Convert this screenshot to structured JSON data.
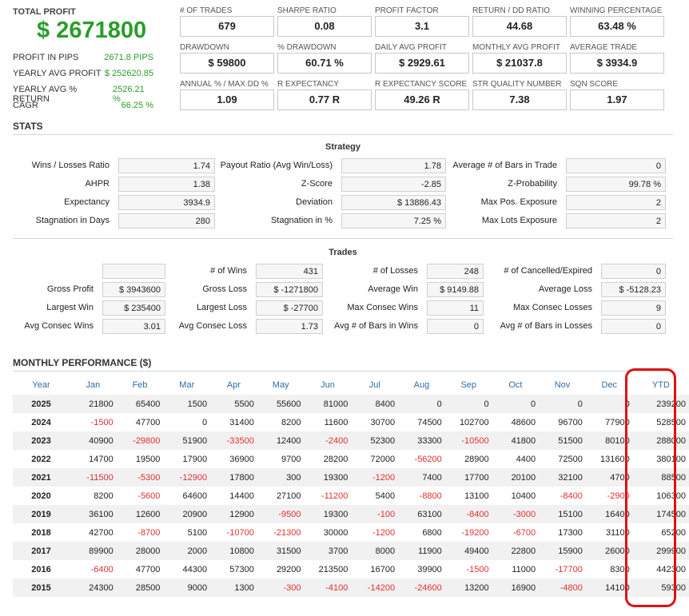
{
  "summary": {
    "total_profit_label": "TOTAL PROFIT",
    "total_profit_value": "$ 2671800",
    "rows": [
      {
        "label": "PROFIT IN PIPS",
        "value": "2671.8 PIPS"
      },
      {
        "label": "YEARLY AVG PROFIT",
        "value": "$ 252620.85"
      },
      {
        "label": "YEARLY AVG % RETURN",
        "value": "2526.21 %"
      },
      {
        "label": "CAGR",
        "value": "66.25 %"
      }
    ]
  },
  "metrics": [
    {
      "label": "# OF TRADES",
      "value": "679"
    },
    {
      "label": "SHARPE RATIO",
      "value": "0.08"
    },
    {
      "label": "PROFIT FACTOR",
      "value": "3.1"
    },
    {
      "label": "RETURN / DD RATIO",
      "value": "44.68"
    },
    {
      "label": "WINNING PERCENTAGE",
      "value": "63.48 %"
    },
    {
      "label": "DRAWDOWN",
      "value": "$ 59800"
    },
    {
      "label": "% DRAWDOWN",
      "value": "60.71 %"
    },
    {
      "label": "DAILY AVG PROFIT",
      "value": "$ 2929.61"
    },
    {
      "label": "MONTHLY AVG PROFIT",
      "value": "$ 21037.8"
    },
    {
      "label": "AVERAGE TRADE",
      "value": "$ 3934.9"
    },
    {
      "label": "ANNUAL % / MAX DD %",
      "value": "1.09"
    },
    {
      "label": "R EXPECTANCY",
      "value": "0.77 R"
    },
    {
      "label": "R EXPECTANCY SCORE",
      "value": "49.26 R"
    },
    {
      "label": "STR QUALITY NUMBER",
      "value": "7.38"
    },
    {
      "label": "SQN SCORE",
      "value": "1.97"
    }
  ],
  "stats_title": "STATS",
  "strategy": {
    "title": "Strategy",
    "rows": [
      [
        {
          "label": "Wins / Losses Ratio",
          "value": "1.74"
        },
        {
          "label": "Payout Ratio (Avg Win/Loss)",
          "value": "1.78"
        },
        {
          "label": "Average # of Bars in Trade",
          "value": "0"
        }
      ],
      [
        {
          "label": "AHPR",
          "value": "1.38"
        },
        {
          "label": "Z-Score",
          "value": "-2.85"
        },
        {
          "label": "Z-Probability",
          "value": "99.78 %"
        }
      ],
      [
        {
          "label": "Expectancy",
          "value": "3934.9"
        },
        {
          "label": "Deviation",
          "value": "$ 13886.43"
        },
        {
          "label": "Max Pos. Exposure",
          "value": "2"
        }
      ],
      [
        {
          "label": "Stagnation in Days",
          "value": "280"
        },
        {
          "label": "Stagnation in %",
          "value": "7.25 %"
        },
        {
          "label": "Max Lots Exposure",
          "value": "2"
        }
      ]
    ]
  },
  "trades": {
    "title": "Trades",
    "rows": [
      [
        {
          "label": "",
          "value": ""
        },
        {
          "label": "# of Wins",
          "value": "431"
        },
        {
          "label": "# of Losses",
          "value": "248"
        },
        {
          "label": "# of Cancelled/Expired",
          "value": "0"
        }
      ],
      [
        {
          "label": "Gross Profit",
          "value": "$ 3943600"
        },
        {
          "label": "Gross Loss",
          "value": "$ -1271800"
        },
        {
          "label": "Average Win",
          "value": "$ 9149.88"
        },
        {
          "label": "Average Loss",
          "value": "$ -5128.23"
        }
      ],
      [
        {
          "label": "Largest Win",
          "value": "$ 235400"
        },
        {
          "label": "Largest Loss",
          "value": "$ -27700"
        },
        {
          "label": "Max Consec Wins",
          "value": "11"
        },
        {
          "label": "Max Consec Losses",
          "value": "9"
        }
      ],
      [
        {
          "label": "Avg Consec Wins",
          "value": "3.01"
        },
        {
          "label": "Avg Consec Loss",
          "value": "1.73"
        },
        {
          "label": "Avg # of Bars in Wins",
          "value": "0"
        },
        {
          "label": "Avg # of Bars in Losses",
          "value": "0"
        }
      ]
    ]
  },
  "monthly": {
    "title": "MONTHLY PERFORMANCE ($)",
    "headers": [
      "Year",
      "Jan",
      "Feb",
      "Mar",
      "Apr",
      "May",
      "Jun",
      "Jul",
      "Aug",
      "Sep",
      "Oct",
      "Nov",
      "Dec",
      "YTD"
    ],
    "rows": [
      [
        "2025",
        "21800",
        "65400",
        "1500",
        "5500",
        "55600",
        "81000",
        "8400",
        "0",
        "0",
        "0",
        "0",
        "0",
        "239200"
      ],
      [
        "2024",
        "-1500",
        "47700",
        "0",
        "31400",
        "8200",
        "11600",
        "30700",
        "74500",
        "102700",
        "48600",
        "96700",
        "77900",
        "528500"
      ],
      [
        "2023",
        "40900",
        "-29800",
        "51900",
        "-33500",
        "12400",
        "-2400",
        "52300",
        "33300",
        "-10500",
        "41800",
        "51500",
        "80100",
        "288000"
      ],
      [
        "2022",
        "14700",
        "19500",
        "17900",
        "36900",
        "9700",
        "28200",
        "72000",
        "-56200",
        "28900",
        "4400",
        "72500",
        "131600",
        "380100"
      ],
      [
        "2021",
        "-11500",
        "-5300",
        "-12900",
        "17800",
        "300",
        "19300",
        "-1200",
        "7400",
        "17700",
        "20100",
        "32100",
        "4700",
        "88500"
      ],
      [
        "2020",
        "8200",
        "-5600",
        "64600",
        "14400",
        "27100",
        "-11200",
        "5400",
        "-8800",
        "13100",
        "10400",
        "-8400",
        "-2900",
        "106300"
      ],
      [
        "2019",
        "36100",
        "12600",
        "20900",
        "12900",
        "-9500",
        "19300",
        "-100",
        "63100",
        "-8400",
        "-3000",
        "15100",
        "16400",
        "174500"
      ],
      [
        "2018",
        "42700",
        "-8700",
        "5100",
        "-10700",
        "-21300",
        "30000",
        "-1200",
        "6800",
        "-19200",
        "-6700",
        "17300",
        "31100",
        "65200"
      ],
      [
        "2017",
        "89900",
        "28000",
        "2000",
        "10800",
        "31500",
        "3700",
        "8000",
        "11900",
        "49400",
        "22800",
        "15900",
        "26000",
        "299900"
      ],
      [
        "2016",
        "-6400",
        "47700",
        "44300",
        "57300",
        "29200",
        "213500",
        "16700",
        "39900",
        "-1500",
        "11000",
        "-17700",
        "8300",
        "442300"
      ],
      [
        "2015",
        "24300",
        "28500",
        "9000",
        "1300",
        "-300",
        "-4100",
        "-14200",
        "-24600",
        "13200",
        "16900",
        "-4800",
        "14100",
        "59300"
      ]
    ]
  },
  "colors": {
    "positive": "#2a9d2a",
    "negative": "#e0302f",
    "header_link": "#2e6da4",
    "highlight": "#e01010"
  }
}
